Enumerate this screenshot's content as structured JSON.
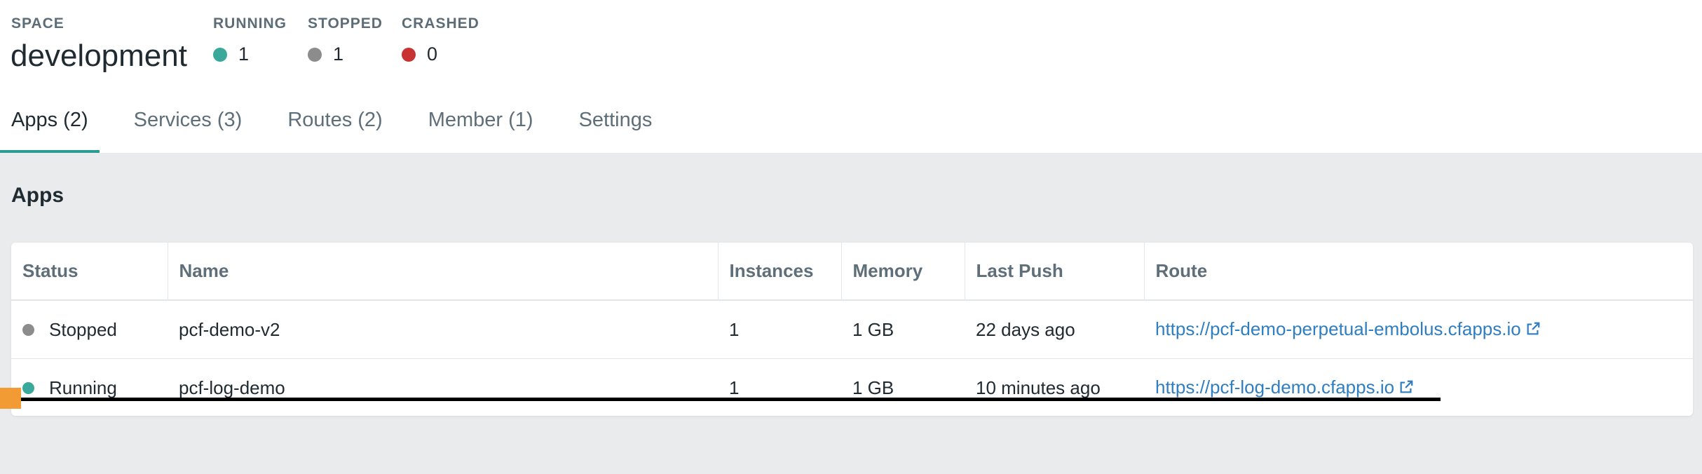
{
  "header": {
    "space_label": "SPACE",
    "space_name": "development",
    "stats": [
      {
        "label": "RUNNING",
        "value": "1",
        "color": "#3aa89b"
      },
      {
        "label": "STOPPED",
        "value": "1",
        "color": "#8c8c8c"
      },
      {
        "label": "CRASHED",
        "value": "0",
        "color": "#c83232"
      }
    ]
  },
  "tabs": [
    {
      "label": "Apps (2)",
      "active": true
    },
    {
      "label": "Services (3)",
      "active": false
    },
    {
      "label": "Routes (2)",
      "active": false
    },
    {
      "label": "Member (1)",
      "active": false
    },
    {
      "label": "Settings",
      "active": false
    }
  ],
  "apps": {
    "title": "Apps",
    "columns": [
      "Status",
      "Name",
      "Instances",
      "Memory",
      "Last Push",
      "Route"
    ],
    "rows": [
      {
        "status": "Stopped",
        "status_color": "#8c8c8c",
        "name": "pcf-demo-v2",
        "instances": "1",
        "memory": "1 GB",
        "last_push": "22 days ago",
        "route": "https://pcf-demo-perpetual-embolus.cfapps.io",
        "route_icon": "external-link-icon"
      },
      {
        "status": "Running",
        "status_color": "#3aa89b",
        "name": "pcf-log-demo",
        "instances": "1",
        "memory": "1 GB",
        "last_push": "10 minutes ago",
        "route": "https://pcf-log-demo.cfapps.io",
        "route_icon": "external-link-icon"
      }
    ]
  },
  "colors": {
    "accent": "#2b9c93",
    "link": "#2f7ec1",
    "annotation_marker": "#f29b34"
  }
}
